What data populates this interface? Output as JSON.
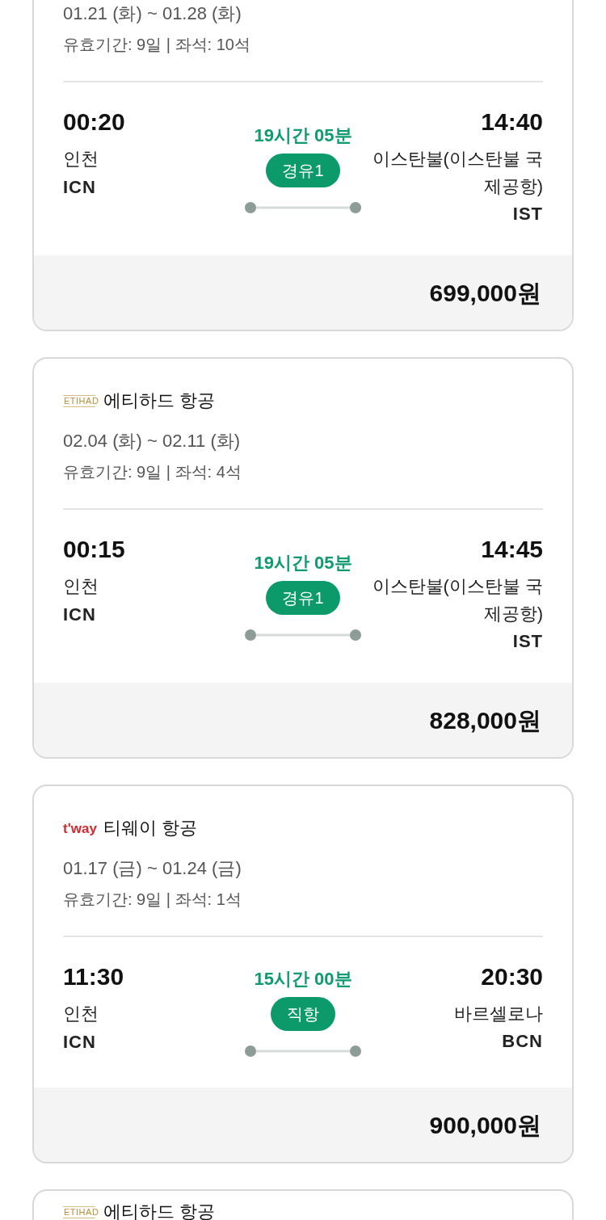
{
  "flights": [
    {
      "dates": "01.21 (화) ~ 01.28 (화)",
      "validity": "유효기간: 9일 | 좌석: 10석",
      "depart": {
        "time": "00:20",
        "city": "인천",
        "code": "ICN"
      },
      "duration": "19시간 05분",
      "stops": "경유1",
      "arrive": {
        "time": "14:40",
        "city": "이스탄불(이스탄불 국제공항)",
        "code": "IST"
      },
      "price": "699,000원"
    },
    {
      "airline": {
        "name": "에티하드 항공",
        "logo": {
          "kind": "etihad",
          "text": "ETIHAD"
        }
      },
      "dates": "02.04 (화) ~ 02.11 (화)",
      "validity": "유효기간: 9일 | 좌석: 4석",
      "depart": {
        "time": "00:15",
        "city": "인천",
        "code": "ICN"
      },
      "duration": "19시간 05분",
      "stops": "경유1",
      "arrive": {
        "time": "14:45",
        "city": "이스탄불(이스탄불 국제공항)",
        "code": "IST"
      },
      "price": "828,000원"
    },
    {
      "airline": {
        "name": "티웨이 항공",
        "logo": {
          "kind": "tway",
          "text": "t'way"
        }
      },
      "dates": "01.17 (금) ~ 01.24 (금)",
      "validity": "유효기간: 9일 | 좌석: 1석",
      "depart": {
        "time": "11:30",
        "city": "인천",
        "code": "ICN"
      },
      "duration": "15시간 00분",
      "stops": "직항",
      "arrive": {
        "time": "20:30",
        "city": "바르셀로나",
        "code": "BCN"
      },
      "price": "900,000원"
    },
    {
      "airline": {
        "name": "에티하드 항공",
        "logo": {
          "kind": "etihad",
          "text": "ETIHAD"
        }
      }
    }
  ]
}
